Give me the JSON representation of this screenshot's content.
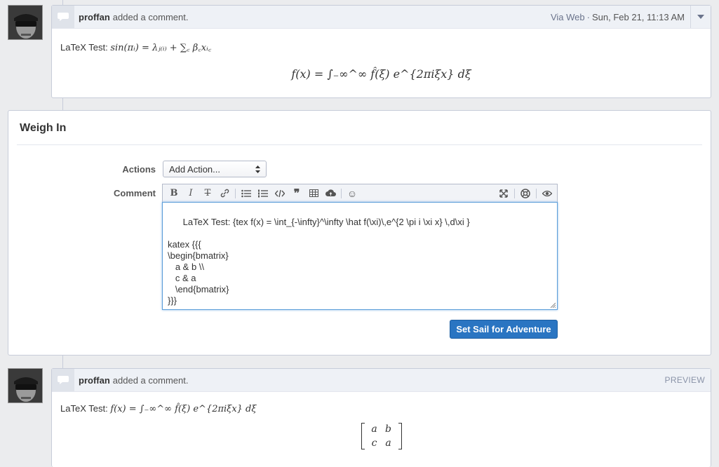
{
  "comments": [
    {
      "author": "proffan",
      "action": "added a comment.",
      "via": "Via Web",
      "date": "Sun, Feb 21, 11:13 AM",
      "inline_prefix": "LaTeX Test:",
      "inline_math": "sin(πᵢ) = λⱼ₍ᵢ₎ + ∑꜀ β꜀xᵢ꜀",
      "block_math": "f(x) = ∫₋∞^∞ f̂(ξ) e^{2πiξx} dξ"
    },
    {
      "author": "proffan",
      "action": "added a comment.",
      "tag": "PREVIEW",
      "inline_prefix": "LaTeX Test:",
      "inline_math": "f(x) = ∫₋∞^∞ f̂(ξ) e^{2πiξx} dξ",
      "matrix": [
        "a",
        "b",
        "c",
        "a"
      ]
    }
  ],
  "weigh_in": {
    "title": "Weigh In",
    "actions_label": "Actions",
    "actions_value": "Add Action...",
    "comment_label": "Comment",
    "text": "LaTeX Test: {tex f(x) = \\int_{-\\infty}^\\infty \\hat f(\\xi)\\,e^{2 \\pi i \\xi x} \\,d\\xi }\n\nkatex {{{\n\\begin{bmatrix}\n   a & b \\\\\n   c & a\n   \\end{bmatrix}\n}}}",
    "submit_label": "Set Sail for Adventure"
  },
  "toolbar_icons": [
    "bold-icon",
    "italic-icon",
    "strikethrough-icon",
    "link-icon",
    "bullet-list-icon",
    "numbered-list-icon",
    "code-icon",
    "quote-icon",
    "table-icon",
    "upload-icon",
    "emoji-icon",
    "fullscreen-icon",
    "help-icon",
    "preview-icon"
  ]
}
